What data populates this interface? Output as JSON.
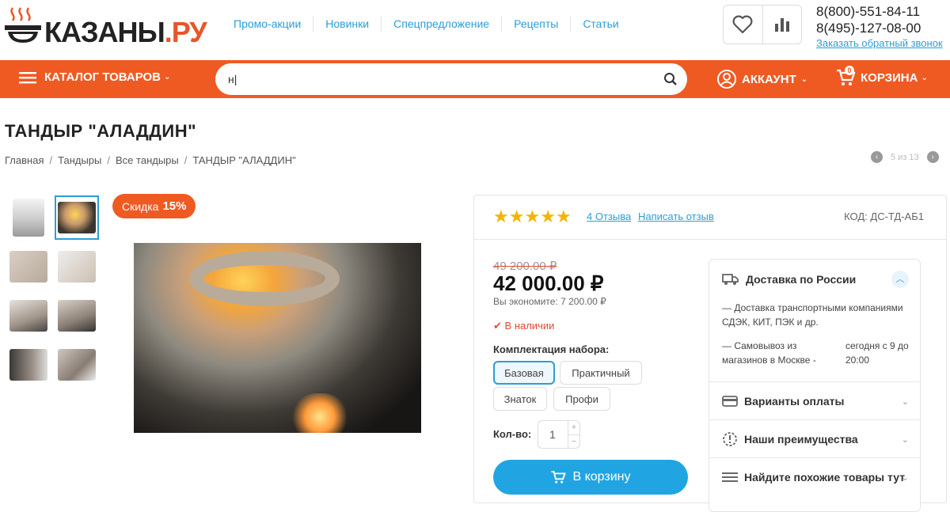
{
  "brand": {
    "logo_main": "КАЗАНЫ",
    "logo_suffix": ".РУ",
    "accent": "#ef5a22",
    "link": "#2b9ed6"
  },
  "topnav": [
    "Промо-акции",
    "Новинки",
    "Спецпредложение",
    "Рецепты",
    "Статьи"
  ],
  "contacts": {
    "phone1": "8(800)-551-84-11",
    "phone2": "8(495)-127-08-00",
    "callback": "Заказать обратный звонок"
  },
  "header_icons": [
    "heart-icon",
    "compare-icon"
  ],
  "bar": {
    "catalog": "КАТАЛОГ ТОВАРОВ",
    "search_value": "н|",
    "account": "АККАУНТ",
    "cart": "КОРЗИНА",
    "cart_count": "0"
  },
  "product": {
    "title": "ТАНДЫР \"АЛАДДИН\"",
    "breadcrumbs": [
      "Главная",
      "Тандыры",
      "Все тандыры",
      "ТАНДЫР \"АЛАДДИН\""
    ],
    "pager": "5 из 13",
    "discount_label": "Скидка",
    "discount_value": "15%",
    "rating": 5,
    "reviews": "4 Отзыва",
    "write_review": "Написать отзыв",
    "sku": "КОД: ДС-ТД-АБ1",
    "old_price": "49 200.00 ₽",
    "price": "42 000.00 ₽",
    "savings": "Вы экономите: 7 200.00 ₽",
    "stock": "В наличии",
    "set_label": "Комплектация набора:",
    "options": [
      "Базовая",
      "Практичный",
      "Знаток",
      "Профи"
    ],
    "selected_option": "Базовая",
    "qty_label": "Кол-во:",
    "qty": "1",
    "buy": "В корзину"
  },
  "delivery": {
    "title": "Доставка по России",
    "line1": "— Доставка транспортными компаниями СДЭК, КИТ, ПЭК и др.",
    "pickup": "— Самовывоз из магазинов в Москве -",
    "pickup_time": "сегодня с 9 до 20:00",
    "rows": [
      "Варианты оплаты",
      "Наши преимущества",
      "Найдите похожие товары тут"
    ]
  }
}
